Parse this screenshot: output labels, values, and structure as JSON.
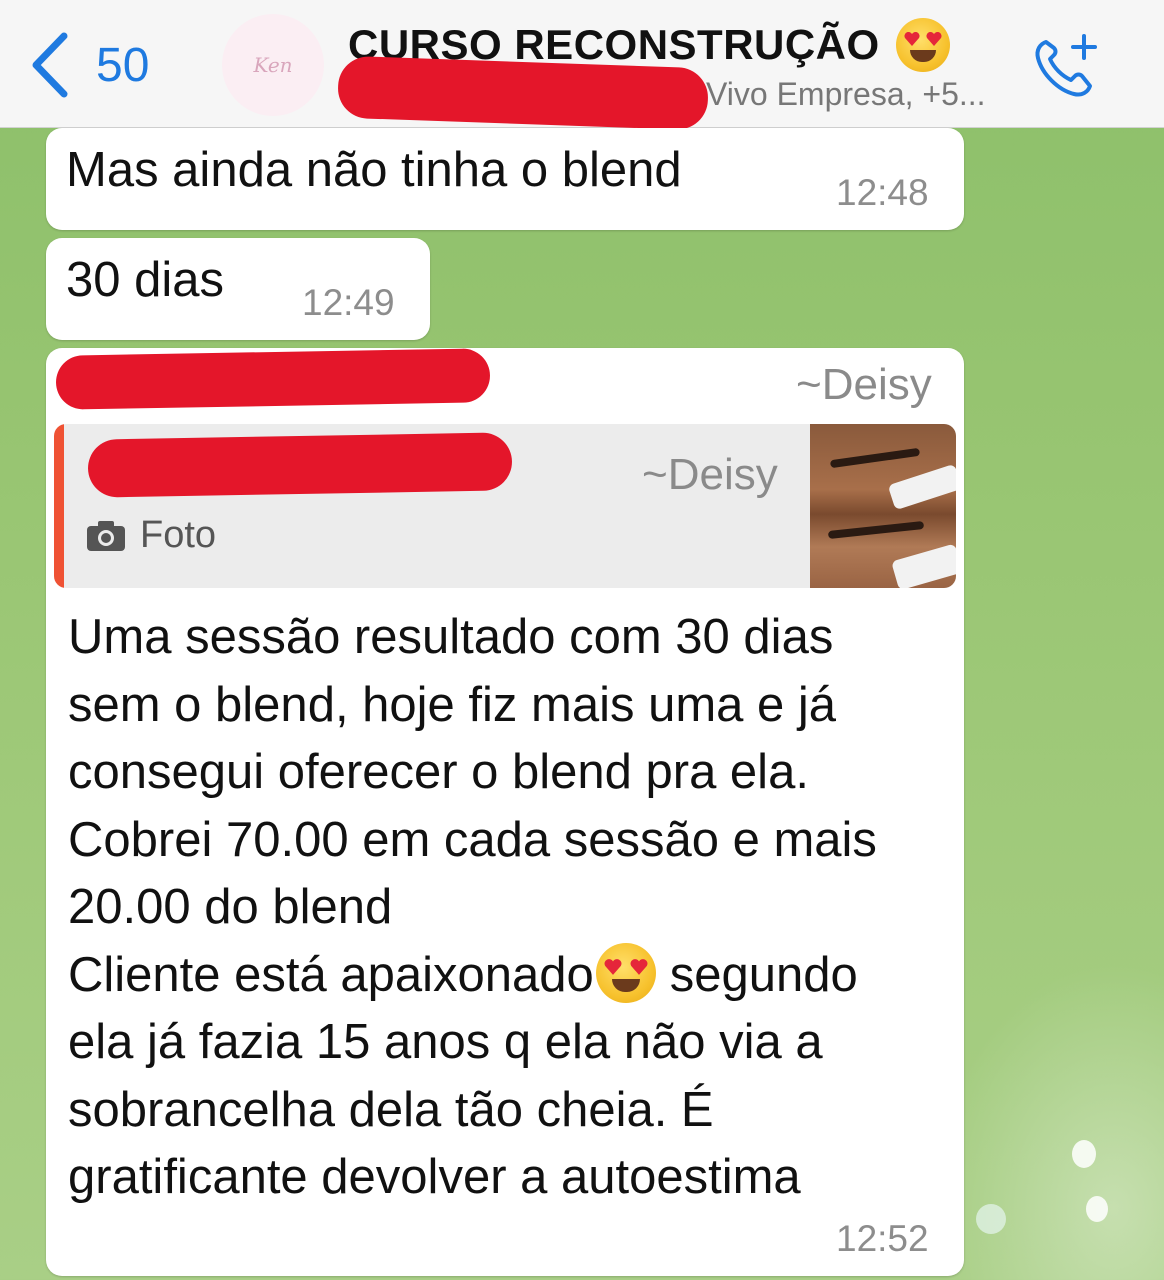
{
  "header": {
    "back_count": "50",
    "avatar_text": "Ken",
    "title": "CURSO RECONSTRUÇÃO",
    "title_emoji": "heart-eyes-emoji",
    "participants": "Vivo Empresa, +5..."
  },
  "messages": [
    {
      "text": "Mas ainda não tinha o blend",
      "time": "12:48"
    },
    {
      "text": "30 dias",
      "time": "12:49"
    },
    {
      "sender": "~Deisy",
      "quote": {
        "sender": "~Deisy",
        "type_label": "Foto"
      },
      "lines": [
        "Uma sessão resultado com 30 dias",
        "sem o blend, hoje fiz mais uma e já",
        "consegui oferecer o blend pra ela.",
        "Cobrei 70.00 em cada sessão e mais",
        "20.00 do blend"
      ],
      "line6_before": "Cliente está apaixonado",
      "line6_after": "segundo",
      "lines_end": [
        "ela já fazia 15 anos q ela não via a",
        "sobrancelha dela tão cheia. É",
        "gratificante devolver a autoestima"
      ],
      "time": "12:52"
    }
  ],
  "colors": {
    "accent": "#1f7ae0",
    "redaction": "#e4162a",
    "quote_bar": "#ef5234",
    "wallpaper": "#96c470"
  }
}
